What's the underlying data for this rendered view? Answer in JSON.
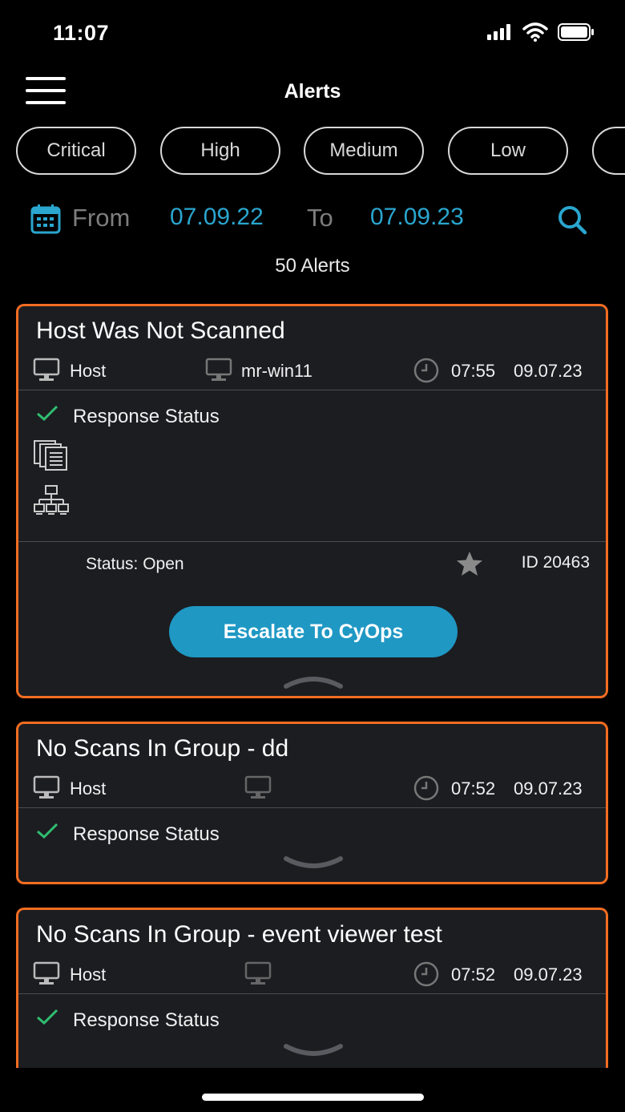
{
  "status_bar": {
    "time": "11:07"
  },
  "header": {
    "title": "Alerts"
  },
  "filters": {
    "chips": [
      {
        "label": "Critical"
      },
      {
        "label": "High"
      },
      {
        "label": "Medium"
      },
      {
        "label": "Low"
      }
    ]
  },
  "date_range": {
    "from_label": "From",
    "from_value": "07.09.22",
    "to_label": "To",
    "to_value": "07.09.23"
  },
  "alerts_count": "50 Alerts",
  "alerts": [
    {
      "title": "Host Was Not Scanned",
      "type": "Host",
      "host_name": "mr-win11",
      "time": "07:55",
      "date": "09.07.23",
      "response_label": "Response Status",
      "status": "Status: Open",
      "id": "ID 20463",
      "escalate_label": "Escalate To CyOps"
    },
    {
      "title": "No Scans In Group - dd",
      "type": "Host",
      "host_name": "",
      "time": "07:52",
      "date": "09.07.23",
      "response_label": "Response Status"
    },
    {
      "title": "No Scans In Group - event viewer test",
      "type": "Host",
      "host_name": "",
      "time": "07:52",
      "date": "09.07.23",
      "response_label": "Response Status"
    }
  ],
  "colors": {
    "accent": "#2aa6cf",
    "card_border": "#f26d21",
    "escalate_button": "#1f98c4",
    "check": "#2fbf71"
  }
}
